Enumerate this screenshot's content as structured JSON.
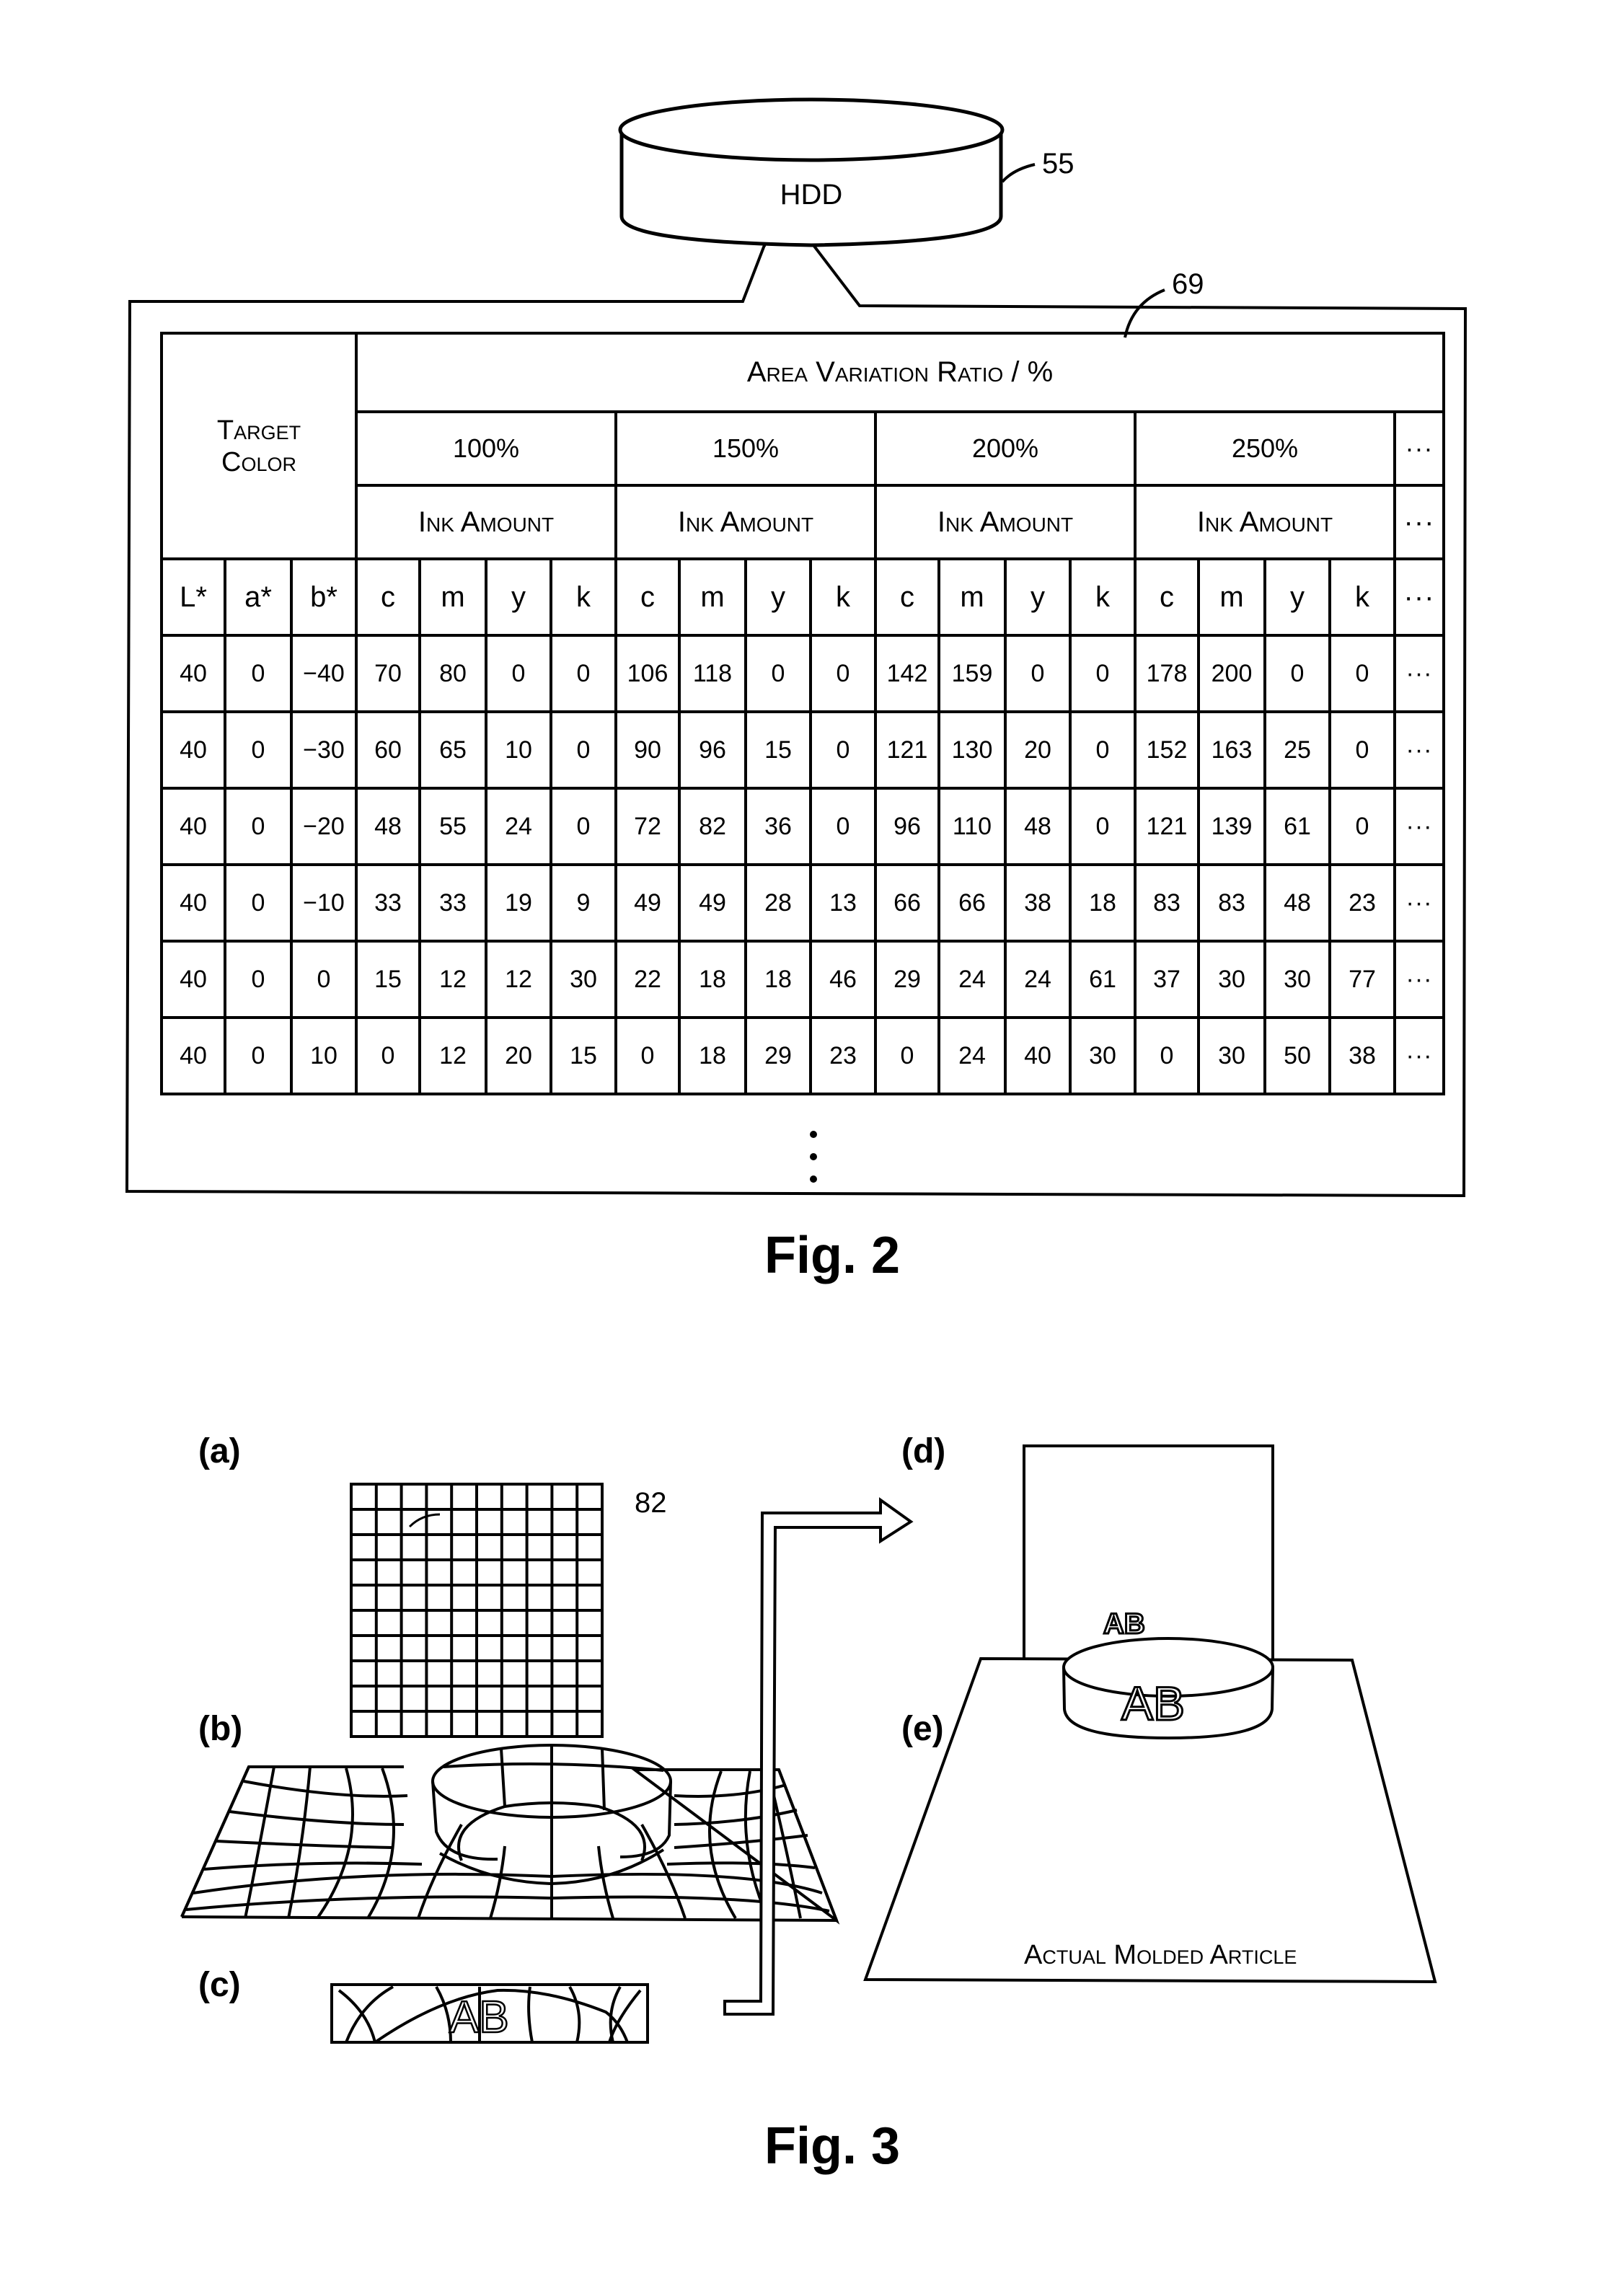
{
  "fig2": {
    "hdd_label": "HDD",
    "hdd_ref": "55",
    "table_ref": "69",
    "caption": "Fig. 2",
    "table": {
      "target_color_label_line1": "Target",
      "target_color_label_line2": "Color",
      "area_variation_header": "Area Variation Ratio / %",
      "ratios": [
        "100%",
        "150%",
        "200%",
        "250%"
      ],
      "ink_amount_label": "Ink Amount",
      "ellipsis": "···",
      "color_columns": [
        "L*",
        "a*",
        "b*"
      ],
      "ink_columns": [
        "c",
        "m",
        "y",
        "k"
      ],
      "rows": [
        {
          "lab": [
            "40",
            "0",
            "−40"
          ],
          "inks": [
            [
              "70",
              "80",
              "0",
              "0"
            ],
            [
              "106",
              "118",
              "0",
              "0"
            ],
            [
              "142",
              "159",
              "0",
              "0"
            ],
            [
              "178",
              "200",
              "0",
              "0"
            ]
          ]
        },
        {
          "lab": [
            "40",
            "0",
            "−30"
          ],
          "inks": [
            [
              "60",
              "65",
              "10",
              "0"
            ],
            [
              "90",
              "96",
              "15",
              "0"
            ],
            [
              "121",
              "130",
              "20",
              "0"
            ],
            [
              "152",
              "163",
              "25",
              "0"
            ]
          ]
        },
        {
          "lab": [
            "40",
            "0",
            "−20"
          ],
          "inks": [
            [
              "48",
              "55",
              "24",
              "0"
            ],
            [
              "72",
              "82",
              "36",
              "0"
            ],
            [
              "96",
              "110",
              "48",
              "0"
            ],
            [
              "121",
              "139",
              "61",
              "0"
            ]
          ]
        },
        {
          "lab": [
            "40",
            "0",
            "−10"
          ],
          "inks": [
            [
              "33",
              "33",
              "19",
              "9"
            ],
            [
              "49",
              "49",
              "28",
              "13"
            ],
            [
              "66",
              "66",
              "38",
              "18"
            ],
            [
              "83",
              "83",
              "48",
              "23"
            ]
          ]
        },
        {
          "lab": [
            "40",
            "0",
            "0"
          ],
          "inks": [
            [
              "15",
              "12",
              "12",
              "30"
            ],
            [
              "22",
              "18",
              "18",
              "46"
            ],
            [
              "29",
              "24",
              "24",
              "61"
            ],
            [
              "37",
              "30",
              "30",
              "77"
            ]
          ]
        },
        {
          "lab": [
            "40",
            "0",
            "10"
          ],
          "inks": [
            [
              "0",
              "12",
              "20",
              "15"
            ],
            [
              "0",
              "18",
              "29",
              "23"
            ],
            [
              "0",
              "24",
              "40",
              "30"
            ],
            [
              "0",
              "30",
              "50",
              "38"
            ]
          ]
        }
      ],
      "vertical_ellipsis": "⋮"
    }
  },
  "fig3": {
    "caption": "Fig. 3",
    "panel_labels": {
      "a": "(a)",
      "b": "(b)",
      "c": "(c)",
      "d": "(d)",
      "e": "(e)"
    },
    "grid_ref": "82",
    "print_text": "AB",
    "actual_article_label": "Actual Molded Article"
  }
}
